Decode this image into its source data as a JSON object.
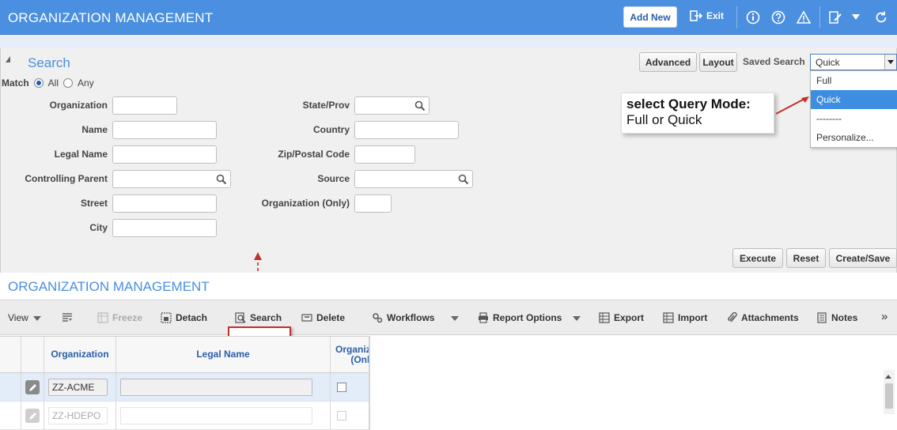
{
  "header": {
    "title": "ORGANIZATION MANAGEMENT",
    "add_new": "Add New",
    "exit": "Exit"
  },
  "search": {
    "title": "Search",
    "match_label": "Match",
    "match_all": "All",
    "match_any": "Any",
    "fields": {
      "organization": "Organization",
      "name": "Name",
      "legal_name": "Legal Name",
      "controlling_parent": "Controlling Parent",
      "street": "Street",
      "city": "City",
      "state_prov": "State/Prov",
      "country": "Country",
      "zip": "Zip/Postal Code",
      "source": "Source",
      "organization_only": "Organization (Only)"
    },
    "advanced": "Advanced",
    "layout": "Layout",
    "saved_search_label": "Saved Search",
    "saved_search_value": "Quick",
    "dropdown_options": [
      "Full",
      "Quick",
      "--------",
      "Personalize..."
    ],
    "execute": "Execute",
    "reset": "Reset",
    "create_save": "Create/Save"
  },
  "callout": {
    "line1": "select Query Mode:",
    "line2": "Full or Quick"
  },
  "grid_section": {
    "title": "ORGANIZATION MANAGEMENT",
    "toolbar": {
      "view": "View",
      "freeze": "Freeze",
      "detach": "Detach",
      "search": "Search",
      "delete": "Delete",
      "workflows": "Workflows",
      "report_options": "Report Options",
      "export": "Export",
      "import": "Import",
      "attachments": "Attachments",
      "notes": "Notes",
      "more": "»"
    },
    "columns": [
      "Organization",
      "Legal Name",
      "Organization (Only)"
    ],
    "rows": [
      {
        "organization": "ZZ-ACME",
        "legal_name": ""
      },
      {
        "organization": "ZZ-HDEPO",
        "legal_name": ""
      }
    ]
  },
  "colors": {
    "header_bg": "#4a8fe0",
    "accent": "#4a8fe0",
    "highlight_red": "#c0312b",
    "selected_blue": "#3d8ee0"
  }
}
